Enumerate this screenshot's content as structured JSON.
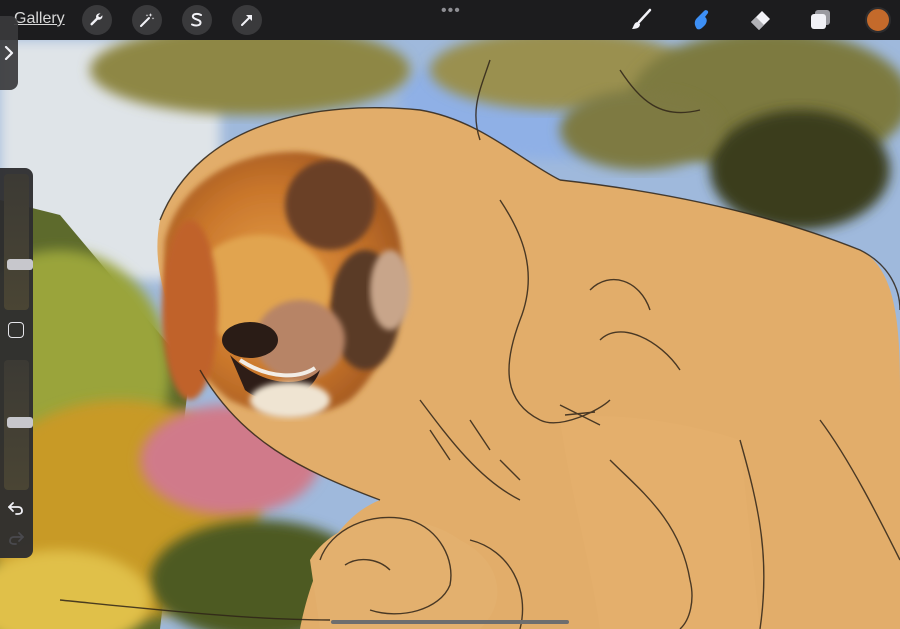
{
  "toolbar": {
    "gallery_label": "Gallery",
    "more_label": "•••",
    "left_tools": [
      {
        "name": "actions-wrench-icon"
      },
      {
        "name": "adjustments-wand-icon"
      },
      {
        "name": "selection-s-icon"
      },
      {
        "name": "transform-arrow-icon"
      }
    ],
    "right_tools": [
      {
        "name": "brush-icon",
        "active": false
      },
      {
        "name": "smudge-icon",
        "active": true
      },
      {
        "name": "eraser-icon",
        "active": false
      },
      {
        "name": "layers-icon",
        "active": false
      }
    ],
    "current_color": "#c46a2b",
    "active_tool_color": "#3d8ff5"
  },
  "sidebar": {
    "brush_size_level": 0.32,
    "opacity_level": 0.52,
    "undo_icon": "undo-icon",
    "redo_icon": "redo-icon",
    "modify_icon": "square-modify-icon"
  }
}
